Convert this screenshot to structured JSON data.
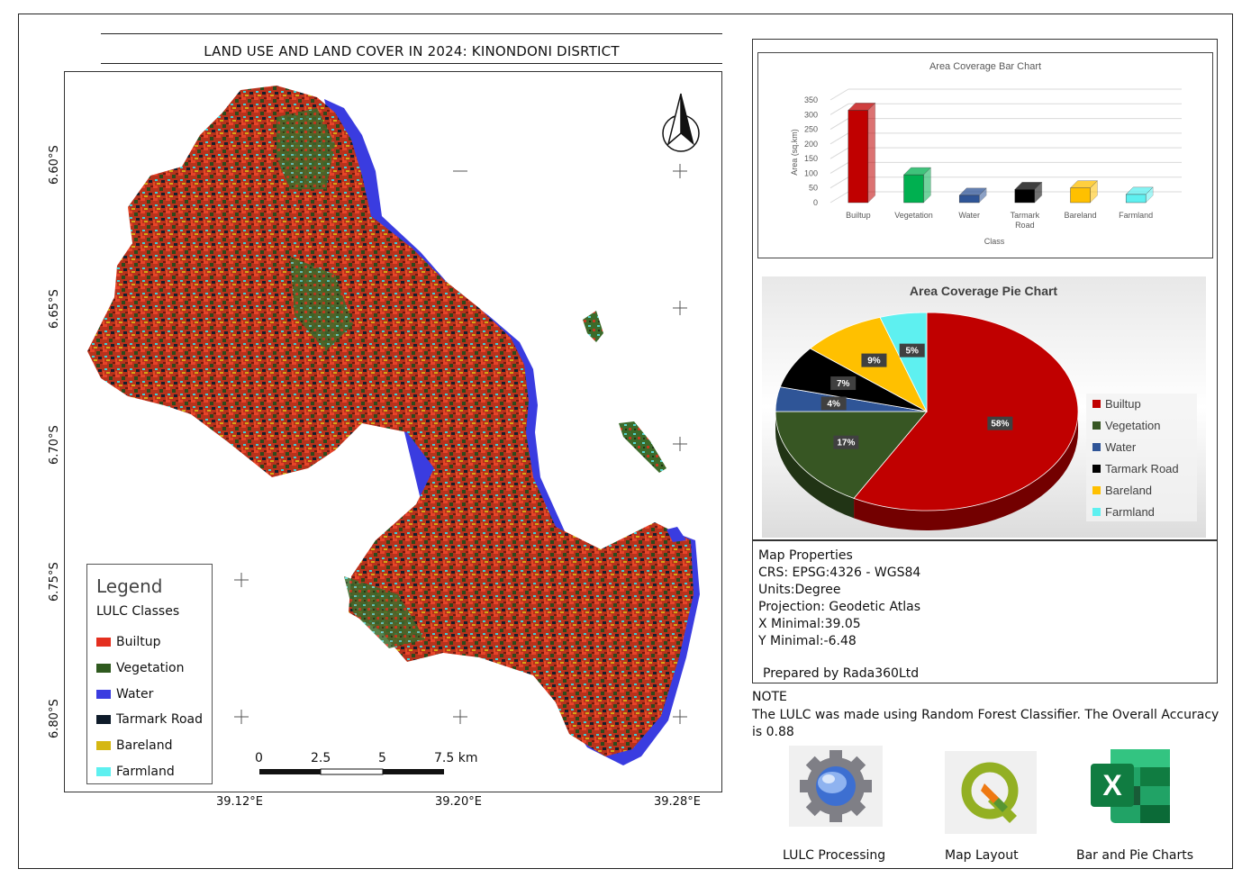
{
  "title": "LAND USE AND  LAND COVER IN 2024: KINONDONI DISRTICT",
  "map": {
    "lat_labels": [
      "6.60°S",
      "6.65°S",
      "6.70°S",
      "6.75°S",
      "6.80°S"
    ],
    "lon_labels": [
      "39.12°E",
      "39.20°E",
      "39.28°E"
    ],
    "north_arrow": "north-arrow-icon"
  },
  "legend": {
    "title": "Legend",
    "subtitle": "LULC Classes",
    "items": [
      {
        "label": "Builtup",
        "color": "#e42f1f"
      },
      {
        "label": "Vegetation",
        "color": "#2f5a1f"
      },
      {
        "label": "Water",
        "color": "#3a3ce0"
      },
      {
        "label": "Tarmark Road",
        "color": "#0e1b2a"
      },
      {
        "label": "Bareland",
        "color": "#d5b712"
      },
      {
        "label": "Farmland",
        "color": "#5ef0f0"
      }
    ]
  },
  "scale": {
    "ticks": [
      "0",
      "2.5",
      "5",
      "7.5 km"
    ]
  },
  "chart_data": [
    {
      "type": "bar",
      "title": "Area Coverage Bar Chart",
      "xlabel": "Class",
      "ylabel": "Area (sq.km)",
      "ylim": [
        0,
        350
      ],
      "yticks": [
        "0",
        "50",
        "100",
        "150",
        "200",
        "250",
        "300",
        "350"
      ],
      "categories": [
        "Builtup",
        "Vegetation",
        "Water",
        "Tarmark Road",
        "Bareland",
        "Farmland"
      ],
      "values": [
        315,
        95,
        25,
        45,
        50,
        28
      ],
      "colors": [
        "#c00000",
        "#00b050",
        "#2f5597",
        "#000000",
        "#ffc000",
        "#5ef0f0"
      ],
      "grid": true
    },
    {
      "type": "pie",
      "title": "Area Coverage Pie Chart",
      "categories": [
        "Builtup",
        "Vegetation",
        "Water",
        "Tarmark Road",
        "Bareland",
        "Farmland"
      ],
      "values": [
        58,
        17,
        4,
        7,
        9,
        5
      ],
      "data_labels": [
        "58%",
        "17%",
        "4%",
        "7%",
        "9%",
        "5%"
      ],
      "colors": [
        "#c00000",
        "#375623",
        "#2f5597",
        "#000000",
        "#ffc000",
        "#5ef0f0"
      ],
      "legend": "right"
    }
  ],
  "properties": {
    "heading": "Map Properties",
    "crs": "CRS: EPSG:4326 - WGS84",
    "units": "Units:Degree",
    "projection": "Projection: Geodetic Atlas",
    "xmin": "X Minimal:39.05",
    "ymin": "Y Minimal:-6.48",
    "prepared": "Prepared by Rada360Ltd"
  },
  "note": {
    "title": "NOTE",
    "text": "The LULC was made using Random Forest Classifier. The Overall Accuracy is 0.88"
  },
  "tools": [
    {
      "label": "LULC Processing",
      "icon": "google-earth-engine-icon"
    },
    {
      "label": "Map Layout",
      "icon": "qgis-icon"
    },
    {
      "label": "Bar and Pie Charts",
      "icon": "excel-icon"
    }
  ]
}
